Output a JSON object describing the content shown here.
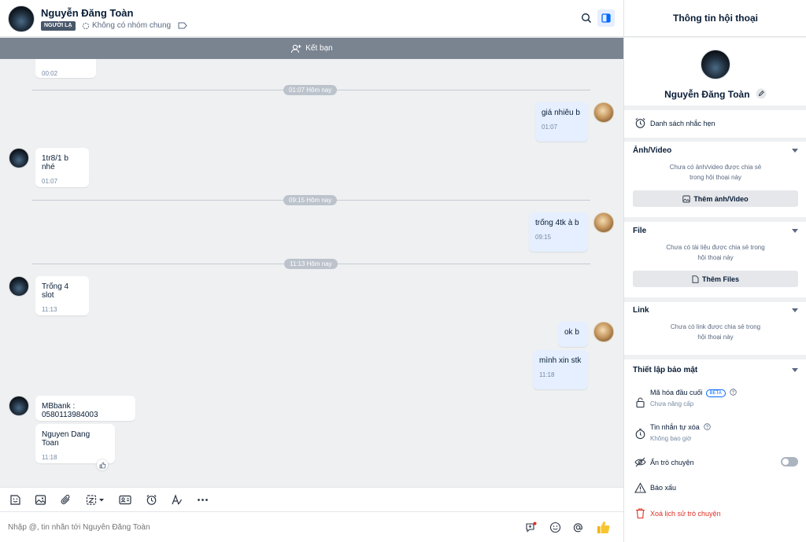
{
  "header": {
    "name": "Nguyễn Đăng Toàn",
    "badge": "NGƯỜI LẠ",
    "no_common_group": "Không có nhóm chung"
  },
  "add_friend_bar": {
    "label": "Kết bạn"
  },
  "messages": {
    "top_partial_time": "00:02",
    "div1": "01:07 Hôm nay",
    "m1_text": "giá nhiêu b",
    "m1_time": "01:07",
    "m2_text": "1tr8/1 b nhé",
    "m2_time": "01:07",
    "div2": "09:15 Hôm nay",
    "m3_text": "trống 4tk à b",
    "m3_time": "09:15",
    "div3": "11:13 Hôm nay",
    "m4_text": "Trống 4 slot",
    "m4_time": "11:13",
    "m5_text": "ok b",
    "m6_text": "mình xin stk",
    "m6_time": "11:18",
    "m7_text": "MBbank : 0580113984003",
    "m8_text": "Nguyen Dang Toan",
    "m8_time": "11:18"
  },
  "toolbar_icons": [
    "sticker-icon",
    "image-icon",
    "attachment-icon",
    "screenshot-icon",
    "contact-card-icon",
    "reminder-icon",
    "format-text-icon",
    "more-icon"
  ],
  "composer": {
    "placeholder": "Nhập @, tin nhắn tới Nguyễn Đăng Toàn"
  },
  "side": {
    "title": "Thông tin hội thoại",
    "name": "Nguyễn Đăng Toàn",
    "reminders": "Danh sách nhắc hẹn",
    "media_title": "Ảnh/Video",
    "media_empty_1": "Chưa có ảnh/video được chia sẻ",
    "media_empty_2": "trong hội thoại này",
    "media_button": "Thêm ảnh/Video",
    "file_title": "File",
    "file_empty_1": "Chưa có tài liệu được chia sẻ trong",
    "file_empty_2": "hội thoại này",
    "file_button": "Thêm Files",
    "link_title": "Link",
    "link_empty_1": "Chưa có link được chia sẻ trong",
    "link_empty_2": "hội thoại này",
    "security_title": "Thiết lập bảo mật",
    "e2e_label": "Mã hóa đầu cuối",
    "e2e_beta": "BETA",
    "e2e_sub": "Chưa nâng cấp",
    "autodelete_label": "Tin nhắn tự xóa",
    "autodelete_sub": "Không bao giờ",
    "hide_chat": "Ẩn trò chuyện",
    "report": "Báo xấu",
    "delete_history": "Xoá lịch sử trò chuyện"
  },
  "colors": {
    "accent": "#0068ff",
    "outgoing_bubble": "#e5efff",
    "danger": "#e02e24",
    "add_friend_bar": "#7a8490"
  }
}
